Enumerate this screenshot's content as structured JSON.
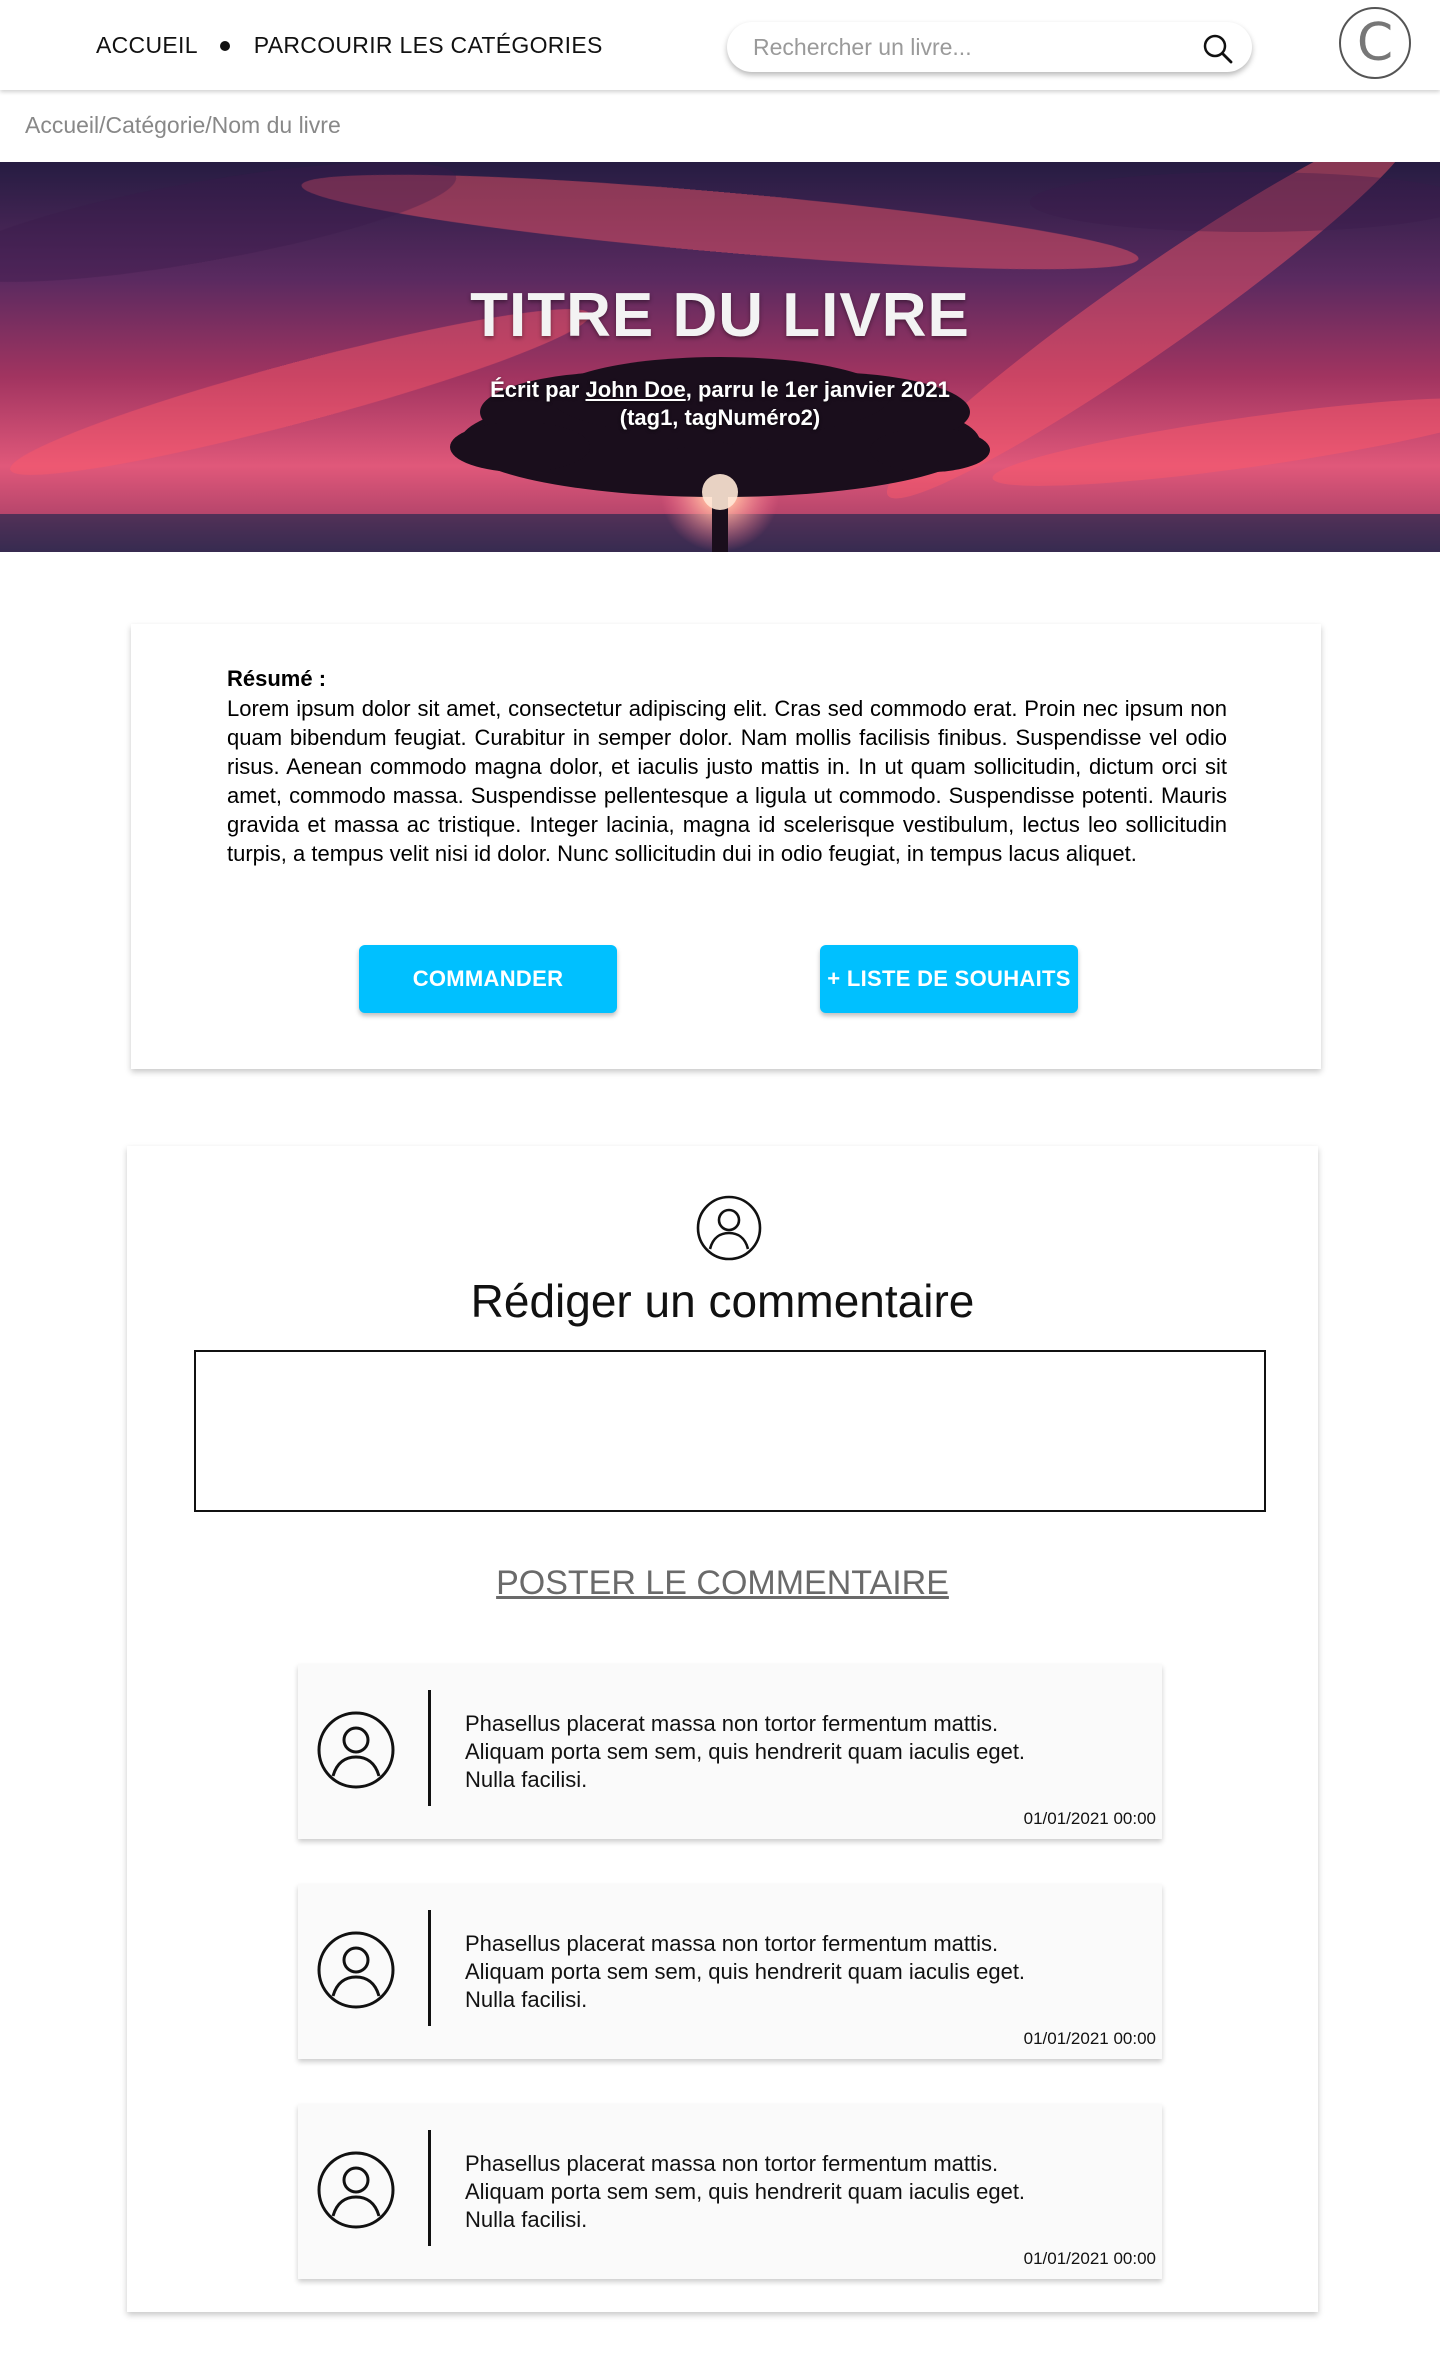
{
  "header": {
    "nav": {
      "home": "ACCUEIL",
      "categories": "PARCOURIR LES CATÉGORIES"
    },
    "search": {
      "placeholder": "Rechercher un livre..."
    },
    "logo": "C"
  },
  "breadcrumb": "Accueil/Catégorie/Nom du livre",
  "hero": {
    "title": "TITRE DU LIVRE",
    "written_by": "Écrit par ",
    "author": "John Doe",
    "published": ", parru le 1er janvier 2021",
    "tags": "(tag1, tagNuméro2)"
  },
  "summary": {
    "label": "Résumé :",
    "text": "Lorem ipsum dolor sit amet, consectetur adipiscing elit. Cras sed commodo erat. Proin nec ipsum non quam bibendum feugiat. Curabitur in semper dolor. Nam mollis facilisis finibus. Suspendisse vel odio risus. Aenean commodo magna dolor, et iaculis justo mattis in. In ut quam sollicitudin, dictum orci sit amet, commodo massa. Suspendisse pellentesque a ligula ut commodo. Suspendisse potenti. Mauris gravida et massa ac tristique. Integer lacinia, magna id scelerisque vestibulum, lectus leo sollicitudin turpis, a tempus velit nisi id dolor. Nunc sollicitudin dui in odio feugiat, in tempus lacus aliquet.",
    "order_button": "COMMANDER",
    "wishlist_button": "+ LISTE DE SOUHAITS"
  },
  "comments": {
    "title": "Rédiger un commentaire",
    "post_button": "POSTER LE COMMENTAIRE",
    "items": [
      {
        "line1": "Phasellus placerat massa non tortor fermentum mattis.",
        "line2": "Aliquam porta sem sem, quis hendrerit quam iaculis eget.",
        "line3": "Nulla facilisi.",
        "date": "01/01/2021 00:00"
      },
      {
        "line1": "Phasellus placerat massa non tortor fermentum mattis.",
        "line2": "Aliquam porta sem sem, quis hendrerit quam iaculis eget.",
        "line3": "Nulla facilisi.",
        "date": "01/01/2021 00:00"
      },
      {
        "line1": "Phasellus placerat massa non tortor fermentum mattis.",
        "line2": "Aliquam porta sem sem, quis hendrerit quam iaculis eget.",
        "line3": "Nulla facilisi.",
        "date": "01/01/2021 00:00"
      }
    ]
  },
  "colors": {
    "accent": "#00c0ff",
    "muted": "#888888"
  },
  "icons": {
    "search": "search-icon",
    "logo": "copyright-logo",
    "user": "user-circle-icon"
  }
}
